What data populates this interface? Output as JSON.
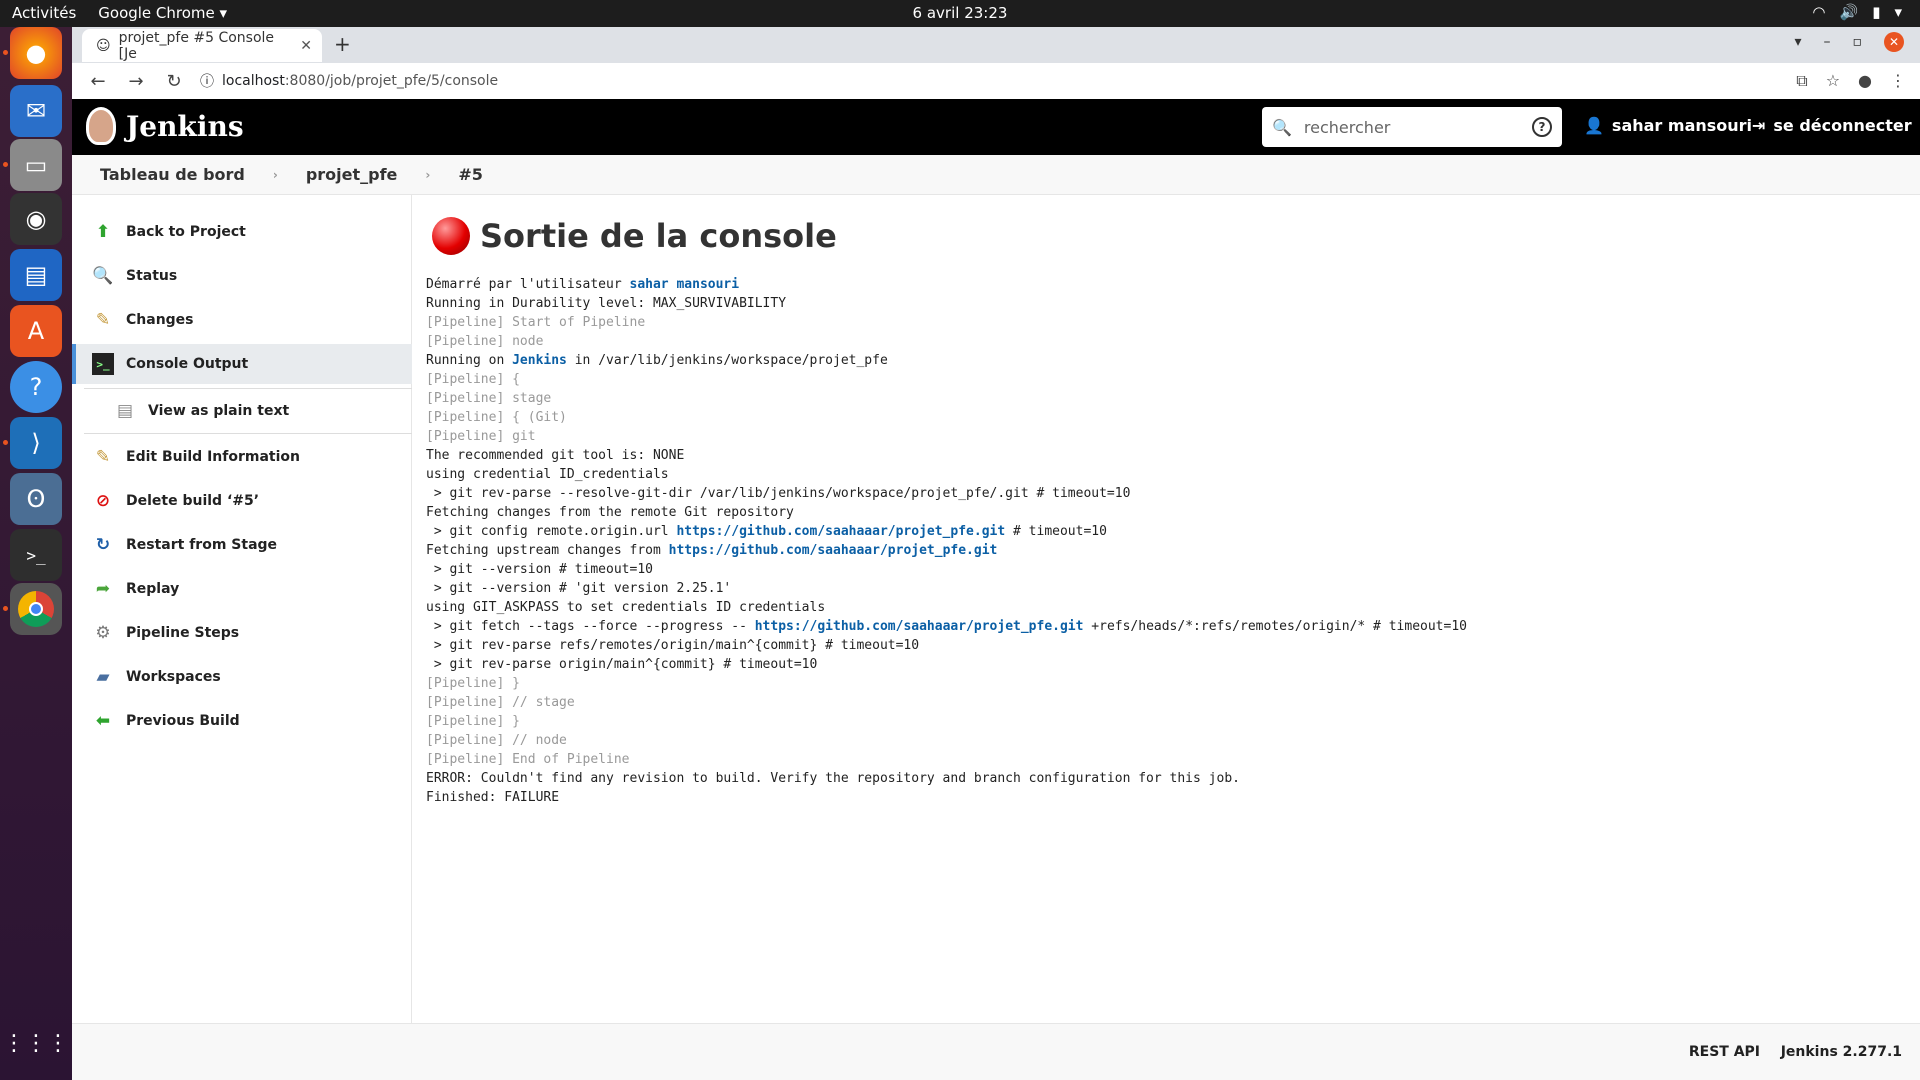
{
  "os": {
    "activities": "Activités",
    "app_menu": "Google Chrome",
    "clock": "6 avril  23:23"
  },
  "browser": {
    "tab_title": "projet_pfe #5 Console [Je",
    "url_host": "localhost",
    "url_path": ":8080/job/projet_pfe/5/console"
  },
  "header": {
    "logo_text": "Jenkins",
    "search_placeholder": "rechercher",
    "user_name": "sahar mansouri",
    "logout_label": "se déconnecter"
  },
  "breadcrumb": [
    "Tableau de bord",
    "projet_pfe",
    "#5"
  ],
  "sidebar": {
    "back_to_project": "Back to Project",
    "status": "Status",
    "changes": "Changes",
    "console_output": "Console Output",
    "view_plain_text": "View as plain text",
    "edit_build_info": "Edit Build Information",
    "delete_build": "Delete build ‘#5’",
    "restart_from_stage": "Restart from Stage",
    "replay": "Replay",
    "pipeline_steps": "Pipeline Steps",
    "workspaces": "Workspaces",
    "previous_build": "Previous Build"
  },
  "main": {
    "title": "Sortie de la console",
    "console": {
      "l1_prefix": "Démarré par l'utilisateur ",
      "l1_user": "sahar mansouri",
      "l2": "Running in Durability level: MAX_SURVIVABILITY",
      "l3": "[Pipeline] Start of Pipeline",
      "l4": "[Pipeline] node",
      "l5_prefix": "Running on ",
      "l5_link": "Jenkins",
      "l5_suffix": " in /var/lib/jenkins/workspace/projet_pfe",
      "l6": "[Pipeline] {",
      "l7": "[Pipeline] stage",
      "l8": "[Pipeline] { (Git)",
      "l9": "[Pipeline] git",
      "l10": "The recommended git tool is: NONE",
      "l11": "using credential ID_credentials",
      "l12": " > git rev-parse --resolve-git-dir /var/lib/jenkins/workspace/projet_pfe/.git # timeout=10",
      "l13": "Fetching changes from the remote Git repository",
      "l14_prefix": " > git config remote.origin.url ",
      "l14_link": "https://github.com/saahaaar/projet_pfe.git",
      "l14_suffix": " # timeout=10",
      "l15_prefix": "Fetching upstream changes from ",
      "l15_link": "https://github.com/saahaaar/projet_pfe.git",
      "l16": " > git --version # timeout=10",
      "l17": " > git --version # 'git version 2.25.1'",
      "l18": "using GIT_ASKPASS to set credentials ID credentials",
      "l19_prefix": " > git fetch --tags --force --progress -- ",
      "l19_link": "https://github.com/saahaaar/projet_pfe.git",
      "l19_suffix": " +refs/heads/*:refs/remotes/origin/* # timeout=10",
      "l20": " > git rev-parse refs/remotes/origin/main^{commit} # timeout=10",
      "l21": " > git rev-parse origin/main^{commit} # timeout=10",
      "l22": "[Pipeline] }",
      "l23": "[Pipeline] // stage",
      "l24": "[Pipeline] }",
      "l25": "[Pipeline] // node",
      "l26": "[Pipeline] End of Pipeline",
      "l27": "ERROR: Couldn't find any revision to build. Verify the repository and branch configuration for this job.",
      "l28": "Finished: FAILURE"
    }
  },
  "footer": {
    "rest_api": "REST API",
    "version": "Jenkins 2.277.1"
  }
}
